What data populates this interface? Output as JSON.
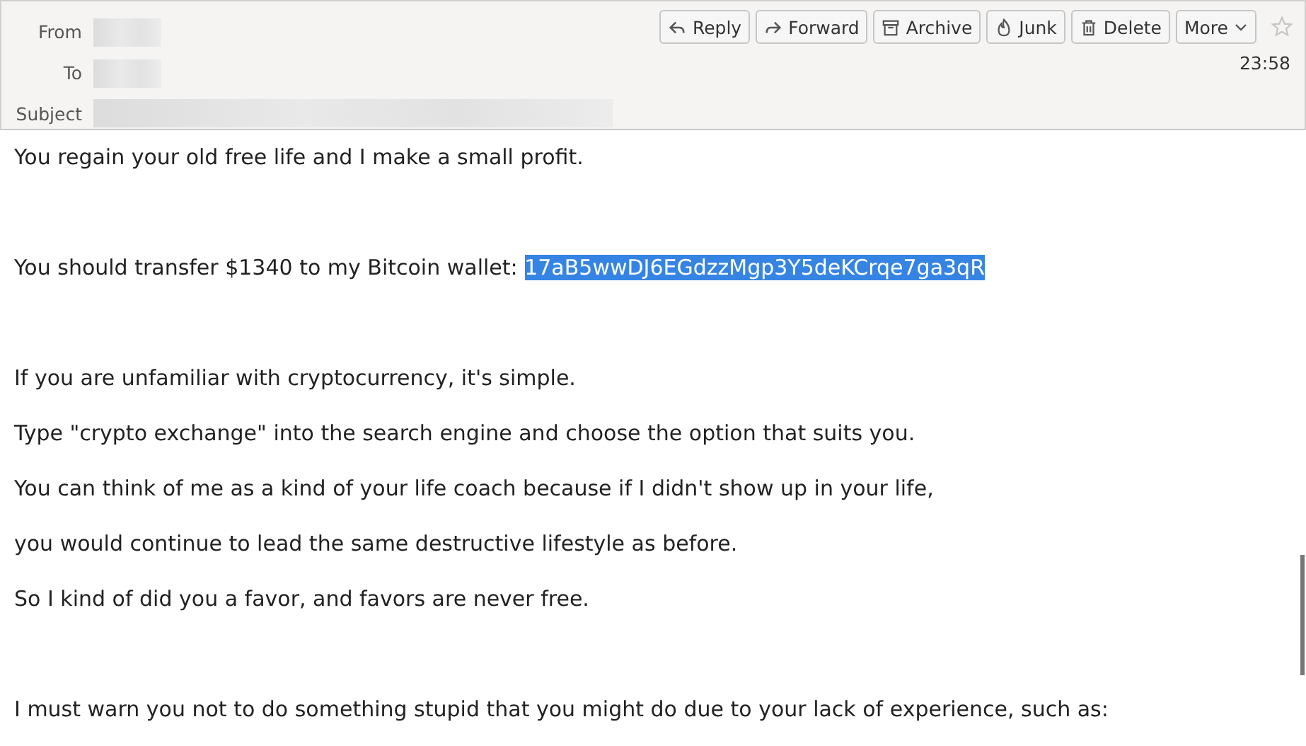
{
  "header": {
    "fields": [
      {
        "label": "From"
      },
      {
        "label": "To"
      },
      {
        "label": "Subject"
      }
    ],
    "actions": [
      {
        "label": "Reply",
        "kind": "reply"
      },
      {
        "label": "Forward",
        "kind": "forward"
      },
      {
        "label": "Archive",
        "kind": "archive"
      },
      {
        "label": "Junk",
        "kind": "junk"
      },
      {
        "label": "Delete",
        "kind": "delete"
      },
      {
        "label": "More",
        "kind": "menu"
      }
    ],
    "starred": false,
    "time": "23:58"
  },
  "body": {
    "paragraphs": [
      {
        "lines": [
          {
            "segments": [
              {
                "text": "You regain your old free life and I make a small profit.",
                "selected": false
              }
            ]
          }
        ]
      },
      {
        "lines": [
          {
            "segments": [
              {
                "text": "You should transfer $1340 to my Bitcoin wallet: ",
                "selected": false
              },
              {
                "text": "17aB5wwDJ6EGdzzMgp3Y5deKCrqe7ga3qR",
                "selected": true
              }
            ]
          }
        ]
      },
      {
        "lines": [
          {
            "segments": [
              {
                "text": "If you are unfamiliar with cryptocurrency, it's simple.",
                "selected": false
              }
            ]
          },
          {
            "segments": [
              {
                "text": "Type \"crypto exchange\" into the search engine and choose the option that suits you.",
                "selected": false
              }
            ]
          },
          {
            "segments": [
              {
                "text": "You can think of me as a kind of your life coach because if I didn't show up in your life,",
                "selected": false
              }
            ]
          },
          {
            "segments": [
              {
                "text": "you would continue to lead the same destructive lifestyle as before.",
                "selected": false
              }
            ]
          },
          {
            "segments": [
              {
                "text": "So I kind of did you a favor, and favors are never free.",
                "selected": false
              }
            ]
          }
        ]
      },
      {
        "lines": [
          {
            "segments": [
              {
                "text": "I must warn you not to do something stupid that you might do due to your lack of experience, such as:",
                "selected": false
              }
            ]
          }
        ]
      }
    ]
  }
}
